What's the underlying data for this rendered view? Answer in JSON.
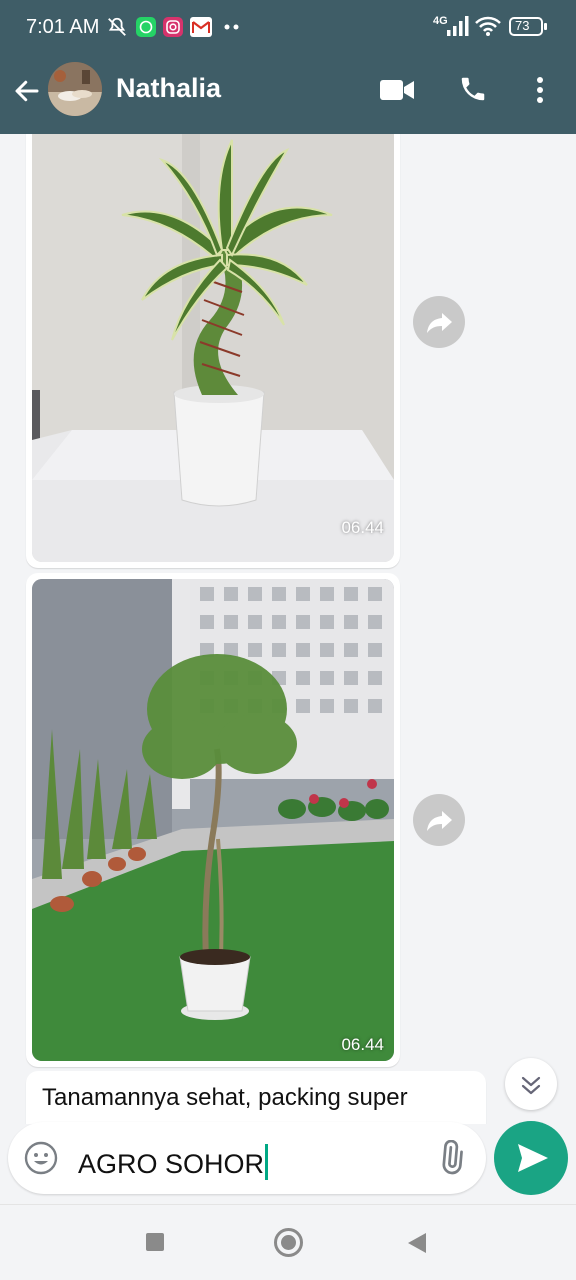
{
  "status_bar": {
    "time": "7:01 AM",
    "network": "4G",
    "battery": "73"
  },
  "header": {
    "contact_name": "Nathalia"
  },
  "messages": [
    {
      "type": "image",
      "timestamp": "06.44",
      "content": "plant-photo-twisted-dracaena"
    },
    {
      "type": "image",
      "timestamp": "06.44",
      "content": "plant-photo-tree-garden"
    },
    {
      "type": "text",
      "text": "Tanamannya sehat, packing super"
    }
  ],
  "composer": {
    "value": "AGRO SOHOR"
  },
  "colors": {
    "header_bg": "#3f5d67",
    "send_button": "#1aa484",
    "chat_bg": "#f3f4f6"
  }
}
